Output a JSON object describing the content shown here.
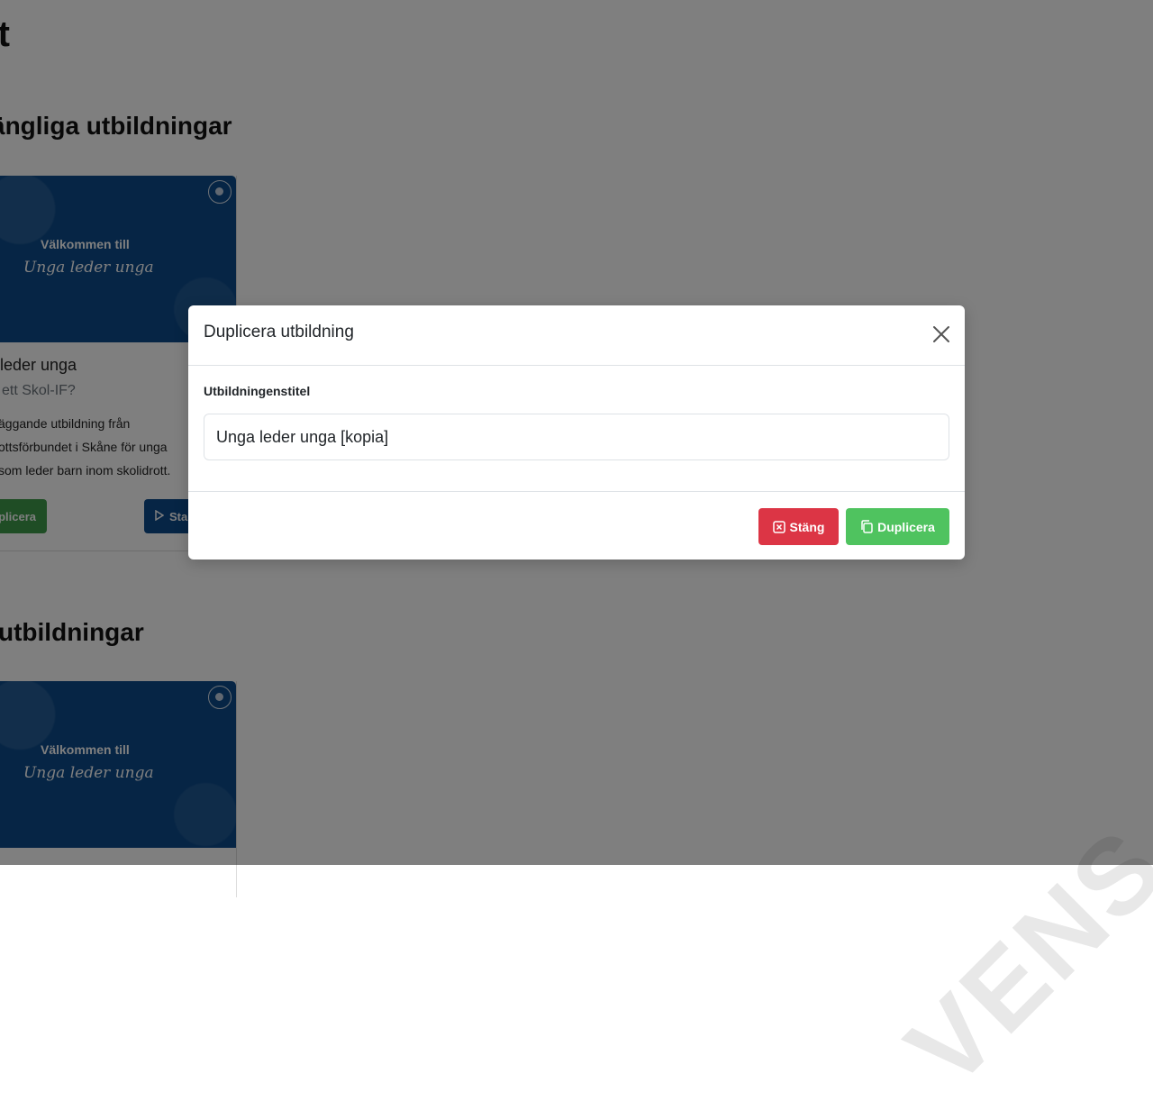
{
  "page": {
    "title_fragment": "rt",
    "section1_title_fragment": "ängliga utbildningar",
    "section2_title_fragment": "utbildningar"
  },
  "cards": [
    {
      "banner_line1": "Välkommen till",
      "banner_line2": "Unga leder unga",
      "title_fragment": "leder unga",
      "subtitle_fragment": "ett Skol-IF?",
      "description_lines": [
        "äggande utbildning från",
        "ottsförbundet i Skåne för unga",
        "som leder barn inom skolidrott."
      ],
      "duplicate_label_fragment": "plicera",
      "start_label_fragment": "Sta"
    },
    {
      "banner_line1": "Välkommen till",
      "banner_line2": "Unga leder unga"
    }
  ],
  "watermark_text": "VENS",
  "modal": {
    "title": "Duplicera utbildning",
    "field_label": "Utbildningenstitel",
    "input_value": "Unga leder unga [kopia]",
    "close_label": "Stäng",
    "duplicate_label": "Duplicera"
  },
  "colors": {
    "overlay": "rgba(0,0,0,0.5)",
    "danger": "#dc3545",
    "success": "#4fc35f",
    "brand_blue": "#0c4a8a"
  },
  "icons": {
    "close": "close-icon",
    "stang": "x-square-icon",
    "duplicate": "copy-icon",
    "play": "play-icon"
  }
}
